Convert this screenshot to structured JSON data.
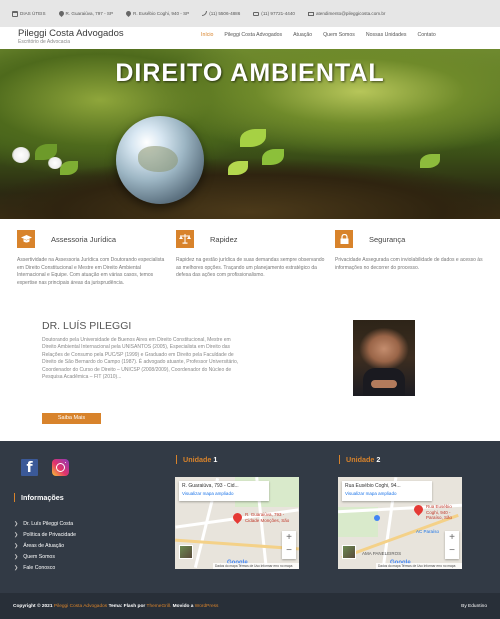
{
  "topbar": {
    "hours": "DIAS ÚTEIS",
    "address1": "R. Guaraiúva, 797 - SP",
    "address2": "R. Eusébio Coghi, 940 - SP",
    "phone": "(11) 5506-4886",
    "fax": "(11) 97721-4440",
    "email": "atendimento@pileggicosta.com.br"
  },
  "header": {
    "logo_title": "Pileggi Costa Advogados",
    "logo_sub": "Escritório de Advocacia",
    "nav": [
      "Início",
      "Pileggi Costa Advogados",
      "Atuação",
      "Quem Somos",
      "Nossas Unidades",
      "Contato"
    ],
    "nav_active_index": 0
  },
  "hero": {
    "title": "DIREITO AMBIENTAL"
  },
  "features": [
    {
      "icon": "graduation-cap-icon",
      "title": "Assessoria Jurídica",
      "text": "Assertividade na Assessoria Jurídica com Doutorando especialista em Direito Constitucional e Mestre em Direito Ambiental Internacional e Equipe. Com atuação em várias casos, temos expertise nas principais áreas da jurisprudência."
    },
    {
      "icon": "scales-icon",
      "title": "Rapidez",
      "text": "Rapidez na gestão jurídica de suas demandas sempre observando as melhores opções. Traçando um planejamento estratégico da defesa das ações com profissionalismo."
    },
    {
      "icon": "lock-icon",
      "title": "Segurança",
      "text": "Privacidade Assegurada com inviolabilidade de dados e acesso às informações no decorrer do processo."
    }
  ],
  "about": {
    "title": "DR. LUÍS PILEGGI",
    "text": "Doutorando pela Universidade de Buenos Aires em Direito Constitucional, Mestre em Direito Ambiental Internacional pela UNISANTOS (2005), Especialista em Direito das Relações de Consumo pela PUC/SP (1999) e Graduado em Direito pela Faculdade de Direito de São Bernardo do Campo (1987). É advogado atuante, Professor Universitário, Coordenador do Curso de Direito – UNICSP (2008/2009), Coordenador do Núcleo de Pesquisa Acadêmica – FIT (2010)...",
    "button": "Saiba Mais"
  },
  "footer": {
    "info_heading": "Informações",
    "links": [
      "Dr. Luís Pileggi Costa",
      "Política de Privacidade",
      "Áreas de Atuação",
      "Quem Somos",
      "Fale Conosco"
    ],
    "unit1": {
      "heading_num": "1",
      "heading_label": "Unidade",
      "card_address": "R. Guaraiúva, 793 - Cid...",
      "card_link": "Visualizar mapa ampliado",
      "pin_label": "R. Guaraiúva, 793 - Cidade Monções, São",
      "attribution": "Dados do mapa   Termos de Uso   Informar erro no mapa"
    },
    "unit2": {
      "heading_num": "2",
      "heading_label": "Unidade",
      "card_address": "Rua Eusébio Coghi, 94...",
      "card_link": "Visualizar mapa ampliado",
      "pin_label": "Rua Eusébio Coghi, 940 - Paraíso, São",
      "place_label": "AC Paraíso",
      "place2_label": "AMA PANELEIROS",
      "attribution": "Dados do mapa   Termos de Uso   Informar erro no mapa"
    },
    "map_brand": "Google"
  },
  "copyright": {
    "prefix": "Copyright © 2021",
    "brand": "Pileggi Costa Advogados",
    "theme_text": "Tema: Flash por",
    "theme_name": "ThemeGrill.",
    "powered": "Movido a",
    "wp": "WordPress",
    "right": "By Eduntino"
  },
  "colors": {
    "accent": "#d8832b",
    "footer_bg": "#323a45",
    "copyright_bg": "#282f38"
  }
}
